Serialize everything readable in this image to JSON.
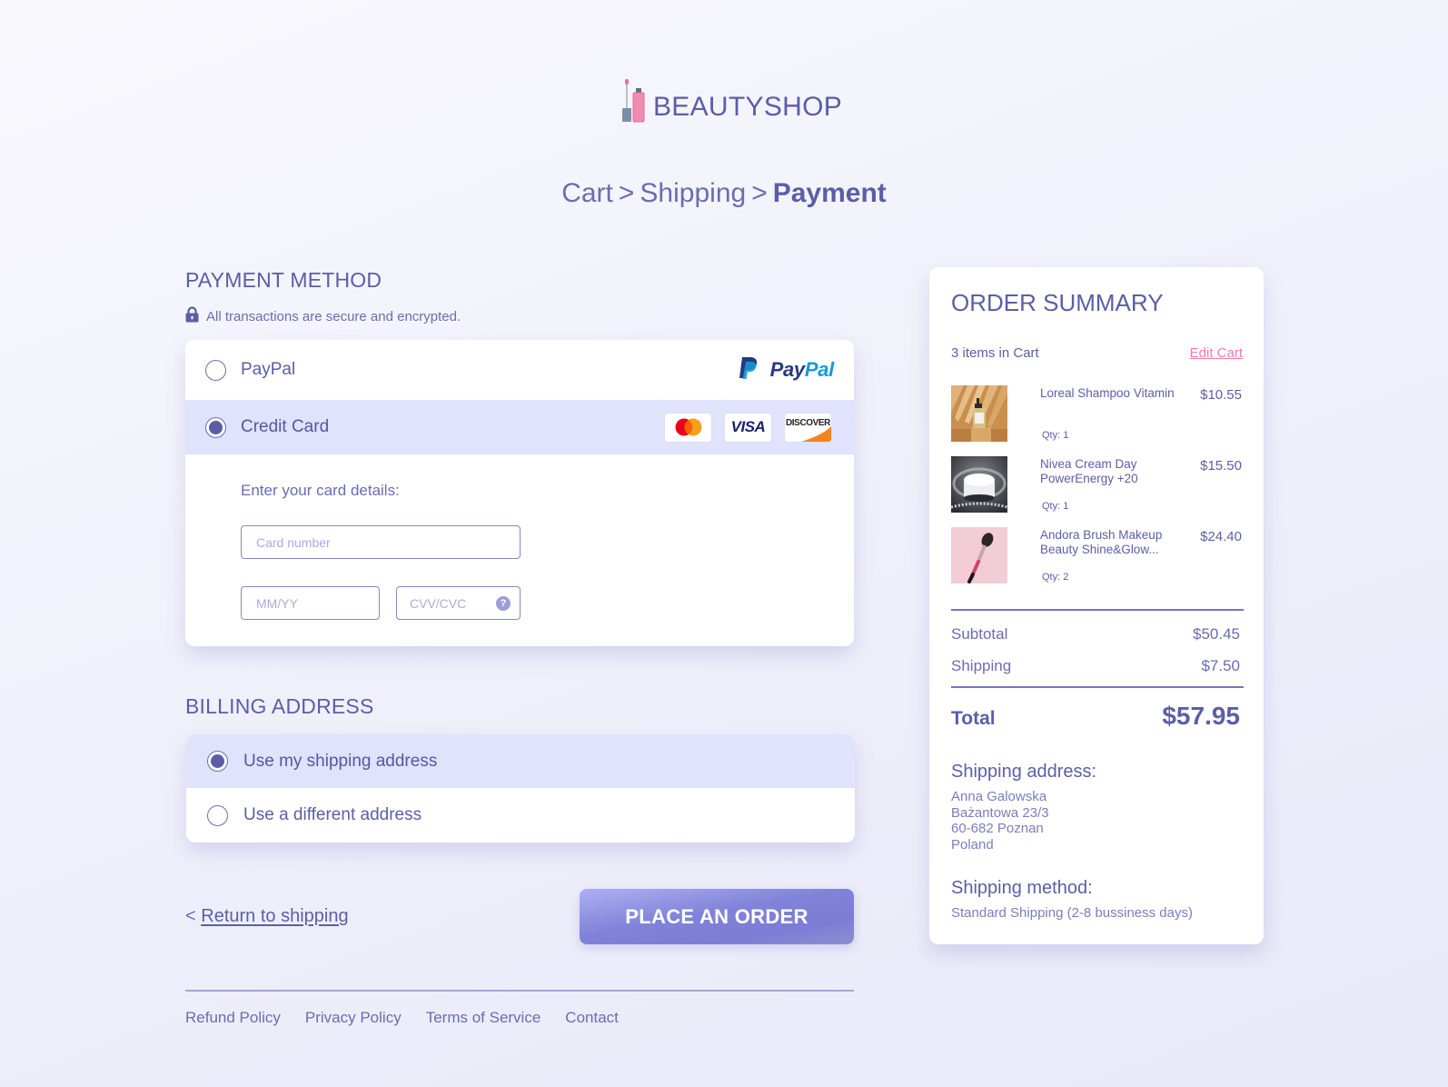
{
  "brand": {
    "name": "BEAUTYSHOP",
    "icon": "lipgloss-logo-icon"
  },
  "breadcrumb": {
    "items": [
      "Cart",
      "Shipping",
      "Payment"
    ],
    "separator": ">",
    "current_index": 2
  },
  "payment": {
    "title": "PAYMENT METHOD",
    "secure_note": "All transactions are secure and encrypted.",
    "options": [
      {
        "label": "PayPal",
        "selected": false,
        "logos": [
          "PayPal"
        ]
      },
      {
        "label": "Credit Card",
        "selected": true,
        "logos": [
          "Mastercard",
          "VISA",
          "DISCOVER"
        ]
      }
    ],
    "paypal_logo_text": {
      "pay": "Pay",
      "pal": "Pal"
    },
    "visa_text": "VISA",
    "discover_text": "DISCOVER",
    "card_details_label": "Enter your card details:",
    "fields": {
      "card_number": {
        "placeholder": "Card number",
        "value": ""
      },
      "expiry": {
        "placeholder": "MM/YY",
        "value": ""
      },
      "cvv": {
        "placeholder": "CVV/CVC",
        "value": "",
        "help": "?"
      }
    }
  },
  "billing": {
    "title": "BILLING ADDRESS",
    "options": [
      {
        "label": "Use my shipping address",
        "selected": true
      },
      {
        "label": "Use a different address",
        "selected": false
      }
    ]
  },
  "actions": {
    "return_prefix": "<",
    "return_label": "Return to shipping",
    "place_order_label": "PLACE AN ORDER"
  },
  "footer": {
    "links": [
      "Refund Policy",
      "Privacy Policy",
      "Terms of Service",
      "Contact"
    ]
  },
  "summary": {
    "title": "ORDER SUMMARY",
    "items_count_label": "3 items in Cart",
    "edit_cart_label": "Edit Cart",
    "items": [
      {
        "name": "Loreal Shampoo Vitamin",
        "qty": "Qty: 1",
        "price": "$10.55",
        "image": "shampoo-bottle"
      },
      {
        "name": "Nivea Cream Day PowerEnergy +20",
        "qty": "Qty: 1",
        "price": "$15.50",
        "image": "cream-jar"
      },
      {
        "name": "Andora Brush Makeup Beauty Shine&Glow...",
        "qty": "Qty: 2",
        "price": "$24.40",
        "image": "makeup-brush"
      }
    ],
    "subtotal_label": "Subtotal",
    "subtotal_value": "$50.45",
    "shipping_label": "Shipping",
    "shipping_value": "$7.50",
    "total_label": "Total",
    "total_value": "$57.95",
    "shipping_address_title": "Shipping address:",
    "shipping_address_lines": [
      "Anna Galowska",
      "Bażantowa 23/3",
      "60-682 Poznan",
      "Poland"
    ],
    "shipping_method_title": "Shipping method:",
    "shipping_method_value": "Standard Shipping (2-8 bussiness days)"
  },
  "colors": {
    "primary": "#5b5ea6",
    "selected_row": "#e1e2fb",
    "accent_pink": "#f47ab0",
    "button_gradient_start": "#aeb0f3",
    "button_gradient_end": "#7b7dd6"
  }
}
